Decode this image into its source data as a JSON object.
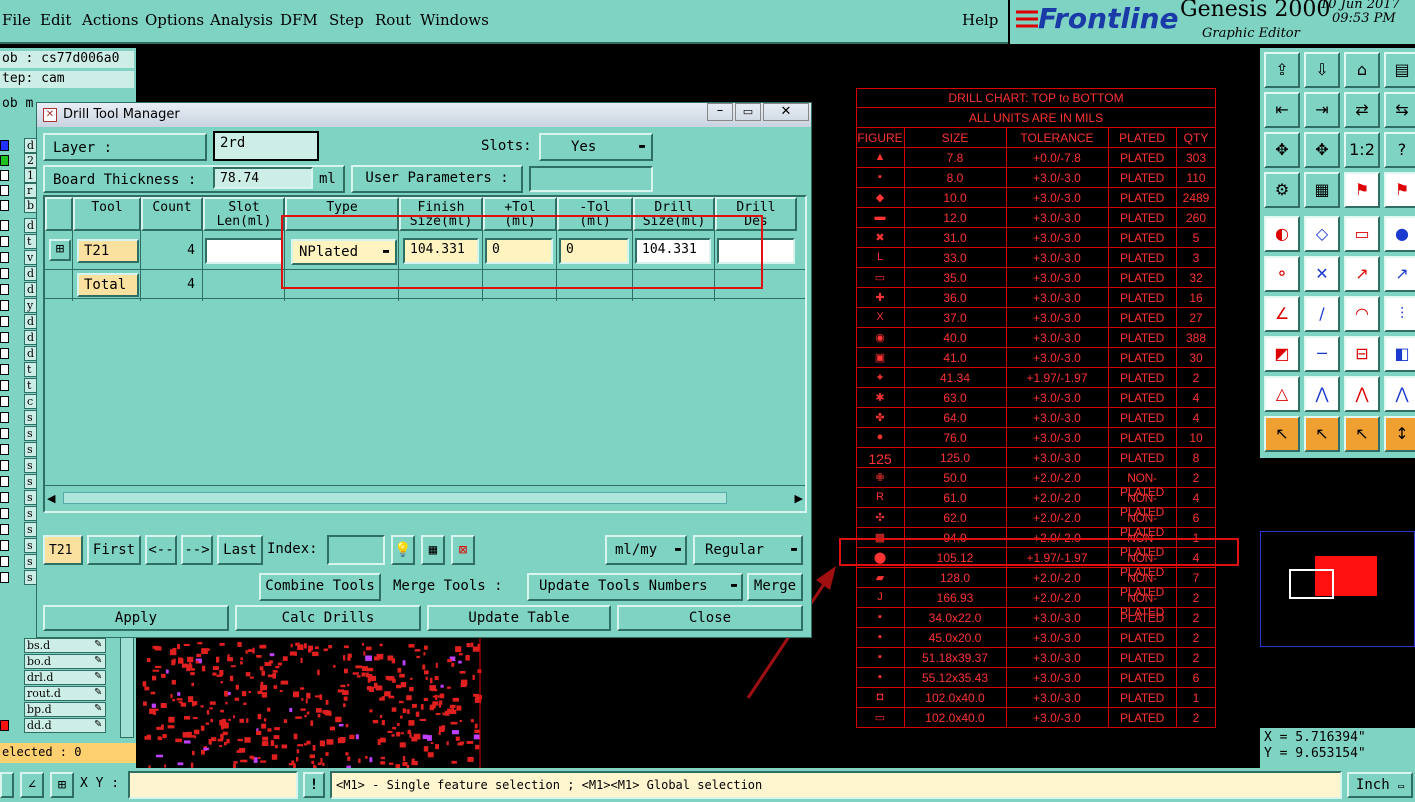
{
  "menu": {
    "items": [
      "File",
      "Edit",
      "Actions",
      "Options",
      "Analysis",
      "DFM",
      "Step",
      "Rout",
      "Windows"
    ],
    "help": "Help"
  },
  "brand": {
    "logo": "Frontline",
    "product": "Genesis 2000",
    "subtitle": "Graphic Editor",
    "date": "10 Jun 2017",
    "time": "09:53 PM"
  },
  "left": {
    "job": "ob : cs77d006a0",
    "step": "tep: cam",
    "job2": "ob m",
    "layers": [
      "d",
      "2",
      "1",
      "r",
      "b",
      "d",
      "t",
      "v",
      "d",
      "d",
      "y",
      "d",
      "d",
      "d",
      "t",
      "t",
      "c",
      "s",
      "s",
      "s",
      "s",
      "s",
      "s",
      "s",
      "s",
      "s",
      "s",
      "s"
    ],
    "named_layers": [
      "bs.d",
      "bo.d",
      "drl.d",
      "rout.d",
      "bp.d",
      "dd.d"
    ],
    "selected": "elected : 0"
  },
  "dialog": {
    "title": "Drill Tool Manager",
    "layer_label": "Layer          :",
    "layer_value": "2rd",
    "slots_label": "Slots:",
    "slots_value": "Yes",
    "thickness_label": "Board Thickness :",
    "thickness_value": "78.74",
    "thickness_unit": "ml",
    "user_params": "User Parameters :",
    "user_params_value": "",
    "columns": [
      {
        "l1": "",
        "l2": ""
      },
      {
        "l1": "Tool",
        "l2": ""
      },
      {
        "l1": "Count",
        "l2": ""
      },
      {
        "l1": "Slot",
        "l2": "Len(ml)"
      },
      {
        "l1": "Type",
        "l2": ""
      },
      {
        "l1": "Finish",
        "l2": "Size(ml)"
      },
      {
        "l1": "+Tol",
        "l2": "(ml)"
      },
      {
        "l1": "-Tol",
        "l2": "(ml)"
      },
      {
        "l1": "Drill",
        "l2": "Size(ml)"
      },
      {
        "l1": "Drill",
        "l2": "Des"
      }
    ],
    "row": {
      "tool": "T21",
      "count": "4",
      "slot_len": "",
      "type": "NPlated",
      "finish": "104.331",
      "plus_tol": "0",
      "minus_tol": "0",
      "drill_size": "104.331",
      "drill_des": ""
    },
    "total": {
      "label": "Total",
      "count": "4"
    },
    "nav": {
      "current": "T21",
      "first": "First",
      "prev": "<--",
      "next": "-->",
      "last": "Last",
      "index_label": "Index:",
      "index_value": "",
      "units": "ml/my",
      "mode": "Regular"
    },
    "combine": "Combine Tools",
    "merge_label": "Merge Tools :",
    "merge_mode": "Update Tools Numbers",
    "merge": "Merge",
    "apply": "Apply",
    "calc": "Calc Drills",
    "update": "Update Table",
    "close": "Close"
  },
  "chart": {
    "title": "DRILL CHART: TOP to BOTTOM",
    "units": "ALL UNITS ARE IN MILS",
    "headers": [
      "FIGURE",
      "SIZE",
      "TOLERANCE",
      "PLATED",
      "QTY"
    ],
    "rows": [
      [
        "▲",
        "7.8",
        "+0.0/-7.8",
        "PLATED",
        "303"
      ],
      [
        "▪",
        "8.0",
        "+3.0/-3.0",
        "PLATED",
        "110"
      ],
      [
        "◆",
        "10.0",
        "+3.0/-3.0",
        "PLATED",
        "2489"
      ],
      [
        "▬",
        "12.0",
        "+3.0/-3.0",
        "PLATED",
        "260"
      ],
      [
        "✖",
        "31.0",
        "+3.0/-3.0",
        "PLATED",
        "5"
      ],
      [
        "L",
        "33.0",
        "+3.0/-3.0",
        "PLATED",
        "3"
      ],
      [
        "▭",
        "35.0",
        "+3.0/-3.0",
        "PLATED",
        "32"
      ],
      [
        "✚",
        "36.0",
        "+3.0/-3.0",
        "PLATED",
        "16"
      ],
      [
        "X",
        "37.0",
        "+3.0/-3.0",
        "PLATED",
        "27"
      ],
      [
        "◉",
        "40.0",
        "+3.0/-3.0",
        "PLATED",
        "388"
      ],
      [
        "▣",
        "41.0",
        "+3.0/-3.0",
        "PLATED",
        "30"
      ],
      [
        "✦",
        "41.34",
        "+1.97/-1.97",
        "PLATED",
        "2"
      ],
      [
        "✱",
        "63.0",
        "+3.0/-3.0",
        "PLATED",
        "4"
      ],
      [
        "✤",
        "64.0",
        "+3.0/-3.0",
        "PLATED",
        "4"
      ],
      [
        "●",
        "76.0",
        "+3.0/-3.0",
        "PLATED",
        "10"
      ],
      [
        "125",
        "125.0",
        "+3.0/-3.0",
        "PLATED",
        "8"
      ],
      [
        "✙",
        "50.0",
        "+2.0/-2.0",
        "NON-PLATED",
        "2"
      ],
      [
        "R",
        "61.0",
        "+2.0/-2.0",
        "NON-PLATED",
        "4"
      ],
      [
        "✣",
        "62.0",
        "+2.0/-2.0",
        "NON-PLATED",
        "6"
      ],
      [
        "▩",
        "94.0",
        "+2.0/-2.0",
        "NON-PLATED",
        "1"
      ],
      [
        "⬤",
        "105.12",
        "+1.97/-1.97",
        "NON-PLATED",
        "4"
      ],
      [
        "▰",
        "128.0",
        "+2.0/-2.0",
        "NON-PLATED",
        "7"
      ],
      [
        "J",
        "166.93",
        "+2.0/-2.0",
        "NON-PLATED",
        "2"
      ],
      [
        "▪",
        "34.0x22.0",
        "+3.0/-3.0",
        "PLATED",
        "2"
      ],
      [
        "▪",
        "45.0x20.0",
        "+3.0/-3.0",
        "PLATED",
        "2"
      ],
      [
        "▪",
        "51.18x39.37",
        "+3.0/-3.0",
        "PLATED",
        "2"
      ],
      [
        "▪",
        "55.12x35.43",
        "+3.0/-3.0",
        "PLATED",
        "6"
      ],
      [
        "◘",
        "102.0x40.0",
        "+3.0/-3.0",
        "PLATED",
        "1"
      ],
      [
        "▭",
        "102.0x40.0",
        "+3.0/-3.0",
        "PLATED",
        "2"
      ]
    ]
  },
  "coords": {
    "x": "X = 5.716394\"",
    "y": "Y = 9.653154\""
  },
  "status": {
    "xy_label": "X Y :",
    "message": "<M1> - Single feature selection ; <M1><M1> Global selection",
    "units": "Inch"
  },
  "colors": {
    "teal": "#7fd3c3",
    "chart_red": "#ff3333",
    "highlight": "#e01010"
  }
}
